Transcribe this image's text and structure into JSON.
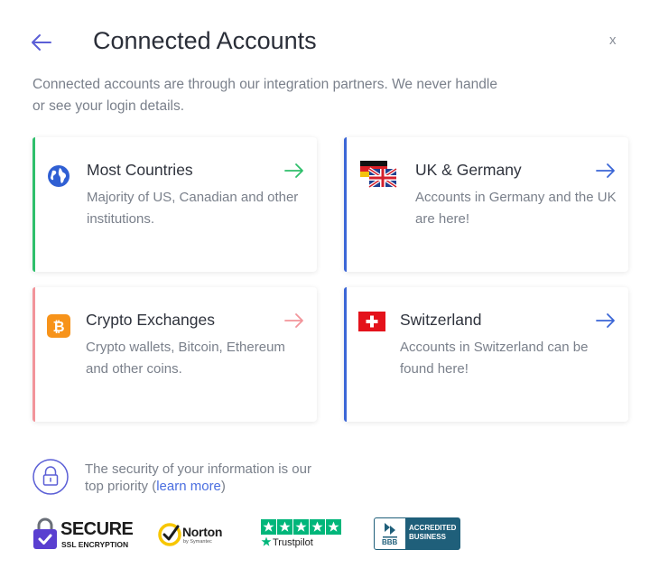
{
  "header": {
    "title": "Connected Accounts",
    "close_label": "x",
    "subtitle": "Connected accounts are through our integration partners. We never handle or see your login details."
  },
  "cards": [
    {
      "title": "Most Countries",
      "description": "Majority of US, Canadian and other institutions.",
      "accent": "#2ebf6b",
      "icon": "globe-icon"
    },
    {
      "title": "UK & Germany",
      "description": "Accounts in Germany and the UK are here!",
      "accent": "#3b66d6",
      "icon": "uk-germany-flags-icon"
    },
    {
      "title": "Crypto Exchanges",
      "description": "Crypto wallets, Bitcoin, Ethereum and other coins.",
      "accent": "#f2949a",
      "icon": "bitcoin-icon"
    },
    {
      "title": "Switzerland",
      "description": "Accounts in Switzerland can be found here!",
      "accent": "#3b66d6",
      "icon": "swiss-flag-icon"
    }
  ],
  "security": {
    "text_before": "The security of your information is our top priority (",
    "link": "learn more",
    "text_after": ")"
  },
  "badges": {
    "secure_title": "SECURE",
    "secure_sub": "SSL ENCRYPTION",
    "norton_name": "Norton",
    "norton_sub": "by Symantec",
    "trustpilot": "Trustpilot",
    "bbb_line1": "ACCREDITED",
    "bbb_line2": "BUSINESS",
    "bbb_mark": "BBB"
  }
}
